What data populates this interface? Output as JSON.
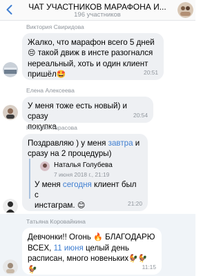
{
  "header": {
    "title": "ЧАТ УЧАСТНИКОВ МАРАФОНА И...",
    "subtitle": "196 участников"
  },
  "messages": [
    {
      "sender": "Виктория Свиридова",
      "lines": [
        "Жалко, что марафон всего 5 дней",
        "такой движ в инсте разогнался",
        "нереальный, хоть и один клиент",
        "пришёл"
      ],
      "emojis": [
        "😔",
        "🤩"
      ],
      "time": "20:51"
    },
    {
      "sender": "Елена Алексеева",
      "lines": [
        "У меня тоже есть новый) и сразу",
        "покупка"
      ],
      "time": "20:54"
    },
    {
      "sender": "Наталия Тарасова",
      "line1_pre": "Поздравляю ) у меня ",
      "line1_link": "завтра",
      "line1_post": " и",
      "line2": "сразу на 2 процедуры)",
      "reply": {
        "name": "Наталья Голубева",
        "date": "7 июня 2018 г., 21:19",
        "line1_pre": "У меня ",
        "line1_link": "сегодня",
        "line1_post": " клиент был с",
        "line2": "инстаграм."
      },
      "emojis": [
        "😊"
      ],
      "time": "21:20"
    },
    {
      "sender": "Татьяна Коровайкина",
      "line1_pre": "Девчонки!! Огонь",
      "line1_post": "БЛАГОДАРЮ",
      "line2_pre": "ВСЕХ, ",
      "line2_link": "11 июня",
      "line2_post": " целый день",
      "line3": "расписан, много новеньких",
      "emojis": [
        "🔥",
        "🐓"
      ],
      "time": "11:15"
    }
  ],
  "colors": {
    "bubble": "#eef0f3",
    "link": "#3f7ed1",
    "meta": "#8f959c",
    "highlight": "#f0f4f8"
  }
}
